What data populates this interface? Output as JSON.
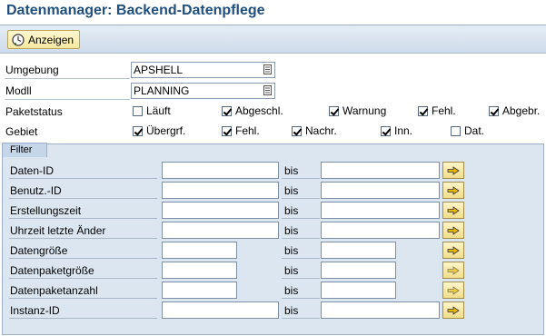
{
  "header": {
    "title": "Datenmanager: Backend-Datenpflege"
  },
  "toolbar": {
    "display_label": "Anzeigen",
    "display_icon": "execute-clock-icon"
  },
  "selection": {
    "umgebung": {
      "label": "Umgebung",
      "value": "APSHELL"
    },
    "modl": {
      "label": "Modll",
      "value": "PLANNING"
    },
    "paketstatus": {
      "label": "Paketstatus",
      "options": [
        {
          "label": "Läuft",
          "checked": false
        },
        {
          "label": "Abgeschl.",
          "checked": true
        },
        {
          "label": "Warnung",
          "checked": true
        },
        {
          "label": "Fehl.",
          "checked": true
        },
        {
          "label": "Abgebr.",
          "checked": true
        }
      ]
    },
    "gebiet": {
      "label": "Gebiet",
      "options": [
        {
          "label": "Übergrf.",
          "checked": true
        },
        {
          "label": "Fehl.",
          "checked": true
        },
        {
          "label": "Nachr.",
          "checked": true
        },
        {
          "label": "Inn.",
          "checked": true
        },
        {
          "label": "Dat.",
          "checked": false
        }
      ]
    }
  },
  "filter": {
    "tab_label": "Filter",
    "bis_label": "bis",
    "rows": [
      {
        "label": "Daten-ID",
        "from": "",
        "to": ""
      },
      {
        "label": "Benutz.-ID",
        "from": "",
        "to": ""
      },
      {
        "label": "Erstellungszeit",
        "from": "",
        "to": ""
      },
      {
        "label": "Uhrzeit letzte Änder",
        "from": "",
        "to": ""
      },
      {
        "label": "Datengröße",
        "from": "",
        "to": ""
      },
      {
        "label": "Datenpaketgröße",
        "from": "",
        "to": ""
      },
      {
        "label": "Datenpaketanzahl",
        "from": "",
        "to": ""
      },
      {
        "label": "Instanz-ID",
        "from": "",
        "to": ""
      }
    ]
  },
  "colors": {
    "title": "#1f4f7d",
    "toolbar": "#cfdceb",
    "filter_bg": "#dbe6f1",
    "button_bg": "#f6e8a0"
  }
}
